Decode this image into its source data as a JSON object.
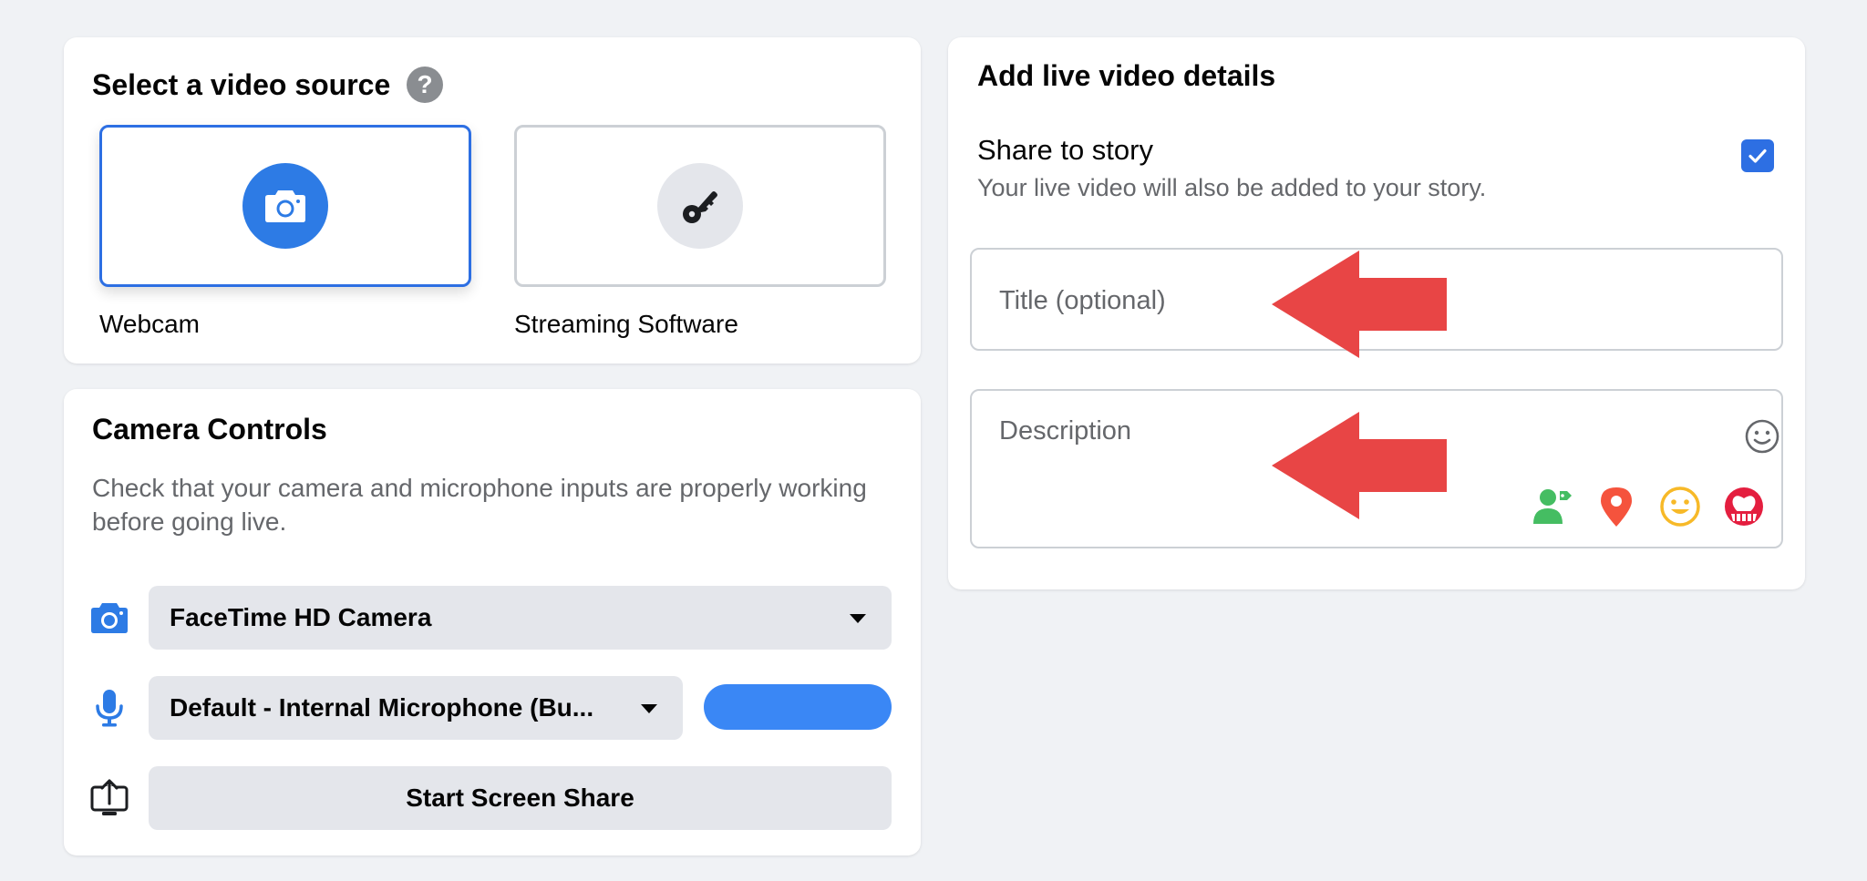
{
  "source": {
    "title": "Select a video source",
    "help_glyph": "?",
    "options": [
      {
        "label": "Webcam",
        "icon": "camera-icon",
        "selected": true
      },
      {
        "label": "Streaming Software",
        "icon": "key-icon",
        "selected": false
      }
    ]
  },
  "camera": {
    "title": "Camera Controls",
    "description": "Check that your camera and microphone inputs are properly working before going live.",
    "camera_select": "FaceTime HD Camera",
    "mic_select": "Default - Internal Microphone (Bu...",
    "screen_share_label": "Start Screen Share"
  },
  "details": {
    "title": "Add live video details",
    "share_story_title": "Share to story",
    "share_story_subtitle": "Your live video will also be added to your story.",
    "share_story_checked": true,
    "title_placeholder": "Title (optional)",
    "description_placeholder": "Description",
    "action_icons": [
      "tag-people-icon",
      "location-pin-icon",
      "feeling-icon",
      "support-icon"
    ]
  },
  "colors": {
    "accent": "#2d6fe3",
    "annotation_arrow": "#e84545",
    "background": "#f0f2f5"
  }
}
